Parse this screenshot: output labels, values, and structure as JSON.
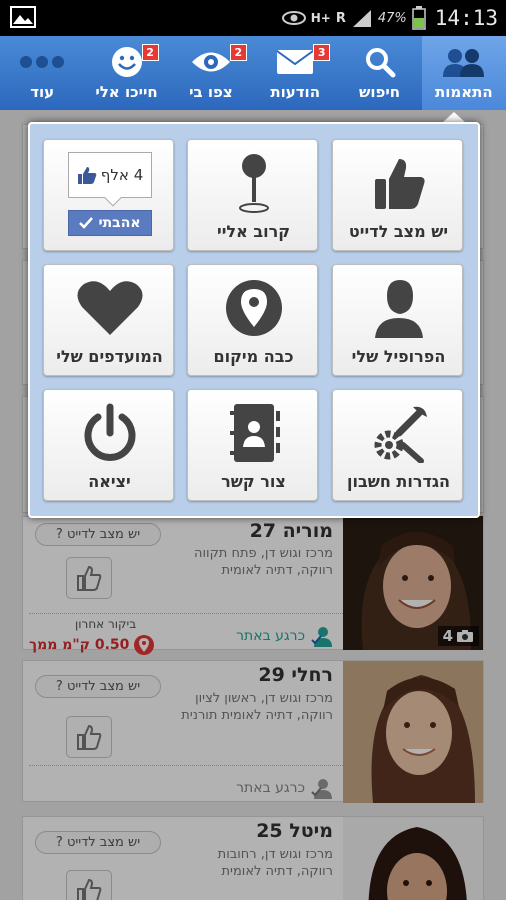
{
  "status_bar": {
    "network_h": "H+",
    "roaming": "R",
    "battery": "47%",
    "time": "14:13"
  },
  "nav": {
    "tabs": [
      {
        "label": "התאמות",
        "icon": "matches-icon",
        "badge": ""
      },
      {
        "label": "חיפוש",
        "icon": "search-icon",
        "badge": ""
      },
      {
        "label": "הודעות",
        "icon": "mail-icon",
        "badge": "3"
      },
      {
        "label": "צפו בי",
        "icon": "eye-icon",
        "badge": "2"
      },
      {
        "label": "חייכו אלי",
        "icon": "smile-icon",
        "badge": "2"
      },
      {
        "label": "עוד",
        "icon": "more-icon",
        "badge": ""
      }
    ],
    "accent": "#3a78cc",
    "badge_color": "#e53935"
  },
  "menu": {
    "items": [
      {
        "label": "יש מצב לדייט",
        "icon": "thumbs-up-icon"
      },
      {
        "label": "קרוב אליי",
        "icon": "map-pin-icon"
      },
      {
        "label": "אהבתי",
        "icon": "like-count-icon",
        "count": "4 אלף",
        "liked": true
      },
      {
        "label": "הפרופיל שלי",
        "icon": "profile-icon"
      },
      {
        "label": "כבה מיקום",
        "icon": "location-off-icon"
      },
      {
        "label": "המועדפים שלי",
        "icon": "heart-icon"
      },
      {
        "label": "הגדרות חשבון",
        "icon": "settings-icon"
      },
      {
        "label": "צור קשר",
        "icon": "contact-book-icon"
      },
      {
        "label": "יציאה",
        "icon": "power-icon"
      }
    ]
  },
  "profiles": [
    {
      "name": "מוריה 27",
      "line1": "מרכז וגוש דן, פתח תקווה",
      "line2": "רווקה, דתיה לאומית",
      "date_label": "יש מצב לדייט ?",
      "online": "כרגע באתר",
      "photos": "4",
      "last_visit": "ביקור אחרון",
      "distance": "0.50 ק\"מ ממך"
    },
    {
      "name": "רחלי 29",
      "line1": "מרכז וגוש דן, ראשון לציון",
      "line2": "רווקה, דתיה לאומית תורנית",
      "date_label": "יש מצב לדייט ?",
      "online": "כרגע באתר"
    },
    {
      "name": "מיטל 25",
      "line1": "מרכז וגוש דן, רחובות",
      "line2": "רווקה, דתיה לאומית",
      "date_label": "יש מצב לדייט ?"
    }
  ],
  "colors": {
    "online_green": "#26a69a",
    "distance_red": "#d32f2f",
    "tile_icon": "#444444"
  }
}
